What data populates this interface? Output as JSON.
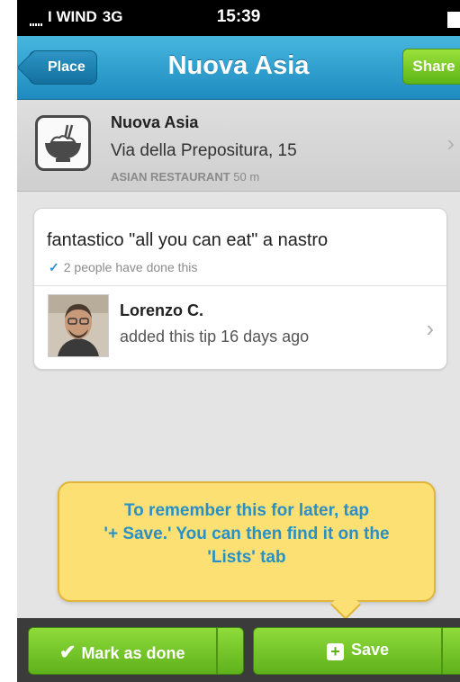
{
  "status_bar": {
    "carrier": "I WIND",
    "network": "3G",
    "time": "15:39"
  },
  "nav": {
    "back_label": "Place",
    "title": "Nuova Asia",
    "share_label": "Share"
  },
  "venue": {
    "icon": "rice-bowl-icon",
    "name": "Nuova Asia",
    "address": "Via della Prepositura, 15",
    "category": "ASIAN RESTAURANT",
    "distance": "50 m"
  },
  "tip": {
    "text": "fantastico \"all you can eat\" a nastro",
    "done_count": "2 people have done this",
    "author": "Lorenzo C.",
    "meta": "added this tip 16 days ago"
  },
  "tooltip": {
    "line1": "To remember this for later, tap",
    "line2": "'+ Save.' You can then find it on the",
    "line3": "'Lists' tab"
  },
  "toolbar": {
    "mark_done_label": "Mark as done",
    "save_label": "Save"
  },
  "colors": {
    "nav_blue": "#1e8bbf",
    "action_green": "#5fb11c",
    "tooltip_yellow": "#fce074",
    "tooltip_text": "#2a90c4"
  }
}
